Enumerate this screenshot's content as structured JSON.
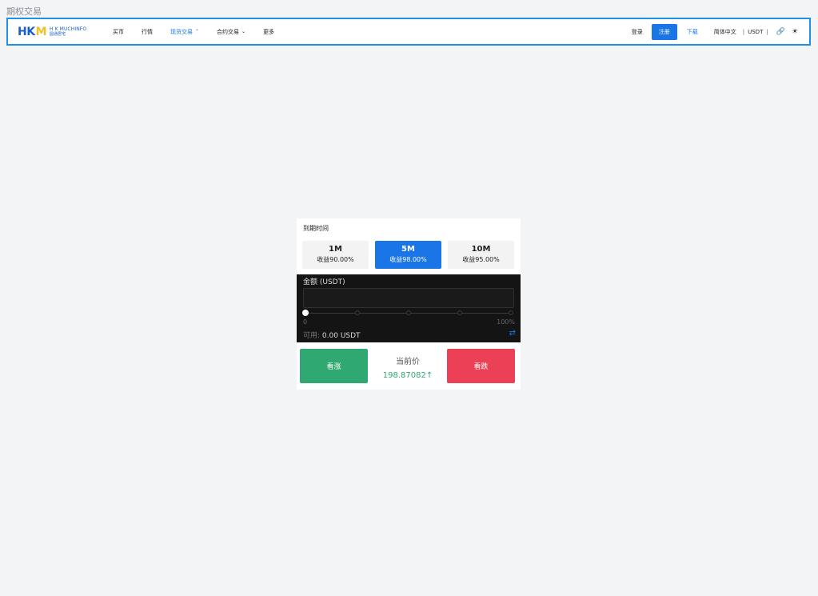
{
  "page_title": "期权交易",
  "header": {
    "logo": {
      "mark_left": "HK",
      "mark_right": "M",
      "name_en": "H K MUCHINFO",
      "name_cn": "圆通居宅"
    },
    "nav": [
      {
        "label": "买币",
        "active": false
      },
      {
        "label": "行情",
        "active": false
      },
      {
        "label": "现货交易",
        "active": true,
        "chevron": "chevron-up-icon"
      },
      {
        "label": "合约交易",
        "active": false,
        "chevron": "chevron-down-icon"
      },
      {
        "label": "更多",
        "active": false
      }
    ],
    "login": "登录",
    "register": "注册",
    "download": "下载",
    "language": "简体中文",
    "separator": "|",
    "currency": "USDT",
    "icons": [
      "link-icon",
      "sun-icon"
    ]
  },
  "trade_panel": {
    "expiry_label": "到期时间",
    "options": [
      {
        "time": "1M",
        "return": "收益90.00%",
        "selected": false
      },
      {
        "time": "5M",
        "return": "收益98.00%",
        "selected": true
      },
      {
        "time": "10M",
        "return": "收益95.00%",
        "selected": false
      }
    ],
    "amount_label": "金额 (USDT)",
    "amount_value": "",
    "slider": {
      "min_label": "0",
      "max_label": "100%",
      "value": 0,
      "steps": [
        0,
        25,
        50,
        75,
        100
      ]
    },
    "available_label": "可用:",
    "available_value": "0.00 USDT",
    "buy_up_label": "看涨",
    "buy_down_label": "看跌",
    "current_price_label": "当前价",
    "current_price_value": "198.87082",
    "price_direction": "up-arrow-icon"
  },
  "colors": {
    "accent": "#1a75e6",
    "up": "#2fa872",
    "down": "#ec4057",
    "frame": "#1e90e6"
  }
}
